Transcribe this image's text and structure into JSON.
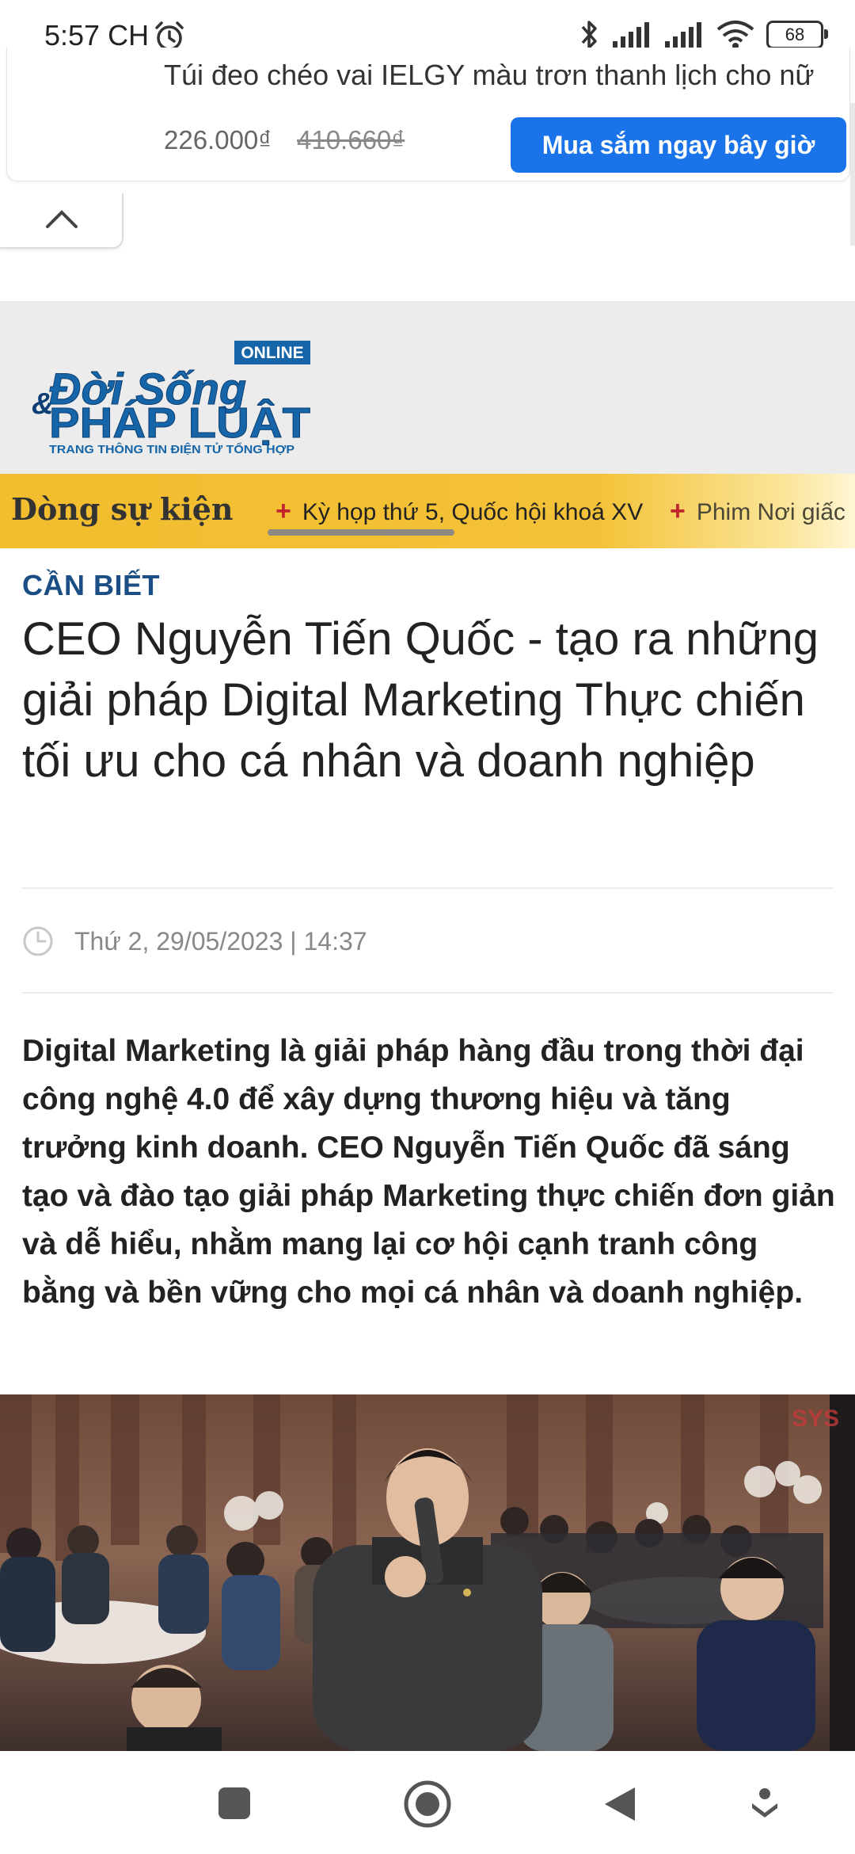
{
  "status_bar": {
    "time": "5:57 CH",
    "battery": "68",
    "icons": [
      "alarm-icon",
      "bluetooth-icon",
      "signal-icon",
      "signal-icon",
      "wifi-icon",
      "battery-icon"
    ]
  },
  "ad": {
    "title": "Túi đeo chéo vai IELGY màu trơn thanh lịch cho nữ",
    "price": "226.000₫",
    "old_price": "410.660₫",
    "cta": "Mua sắm ngay bây giờ"
  },
  "site": {
    "logo_badge": "ONLINE",
    "logo_line1": "Đời Sống",
    "logo_ampersand": "&",
    "logo_line2": "PHÁP LUẬT",
    "logo_tagline": "TRANG THÔNG TIN ĐIỆN TỬ TỔNG HỢP"
  },
  "events": {
    "label": "Dòng sự kiện",
    "items": [
      {
        "label": "Kỳ họp thứ 5, Quốc hội khoá XV"
      },
      {
        "label": "Phim Nơi giấc"
      }
    ]
  },
  "article": {
    "category": "CẦN BIẾT",
    "headline": "CEO Nguyễn Tiến Quốc - tạo ra những giải pháp Digital Marketing Thực chiến tối ưu cho cá nhân và doanh nghiệp",
    "datetime": "Thứ 2, 29/05/2023 | 14:37",
    "lede": "Digital Marketing là giải pháp hàng đầu trong thời đại công nghệ 4.0 để xây dựng thương hiệu và tăng trưởng kinh doanh. CEO Nguyễn Tiến Quốc đã sáng tạo và đào tạo giải pháp Marketing thực chiến đơn giản và dễ hiểu, nhằm mang lại cơ hội cạnh tranh công bằng và bền vững cho mọi cá nhân và doanh nghiệp.",
    "photo_watermark": "SYS"
  },
  "colors": {
    "accent": "#1a73e8",
    "category": "#1b4e84",
    "events_bar": "#f2bd2e",
    "logo_blue": "#1565a8"
  },
  "nav": {
    "icons": [
      "recents-icon",
      "home-icon",
      "back-icon",
      "assistant-icon"
    ]
  }
}
